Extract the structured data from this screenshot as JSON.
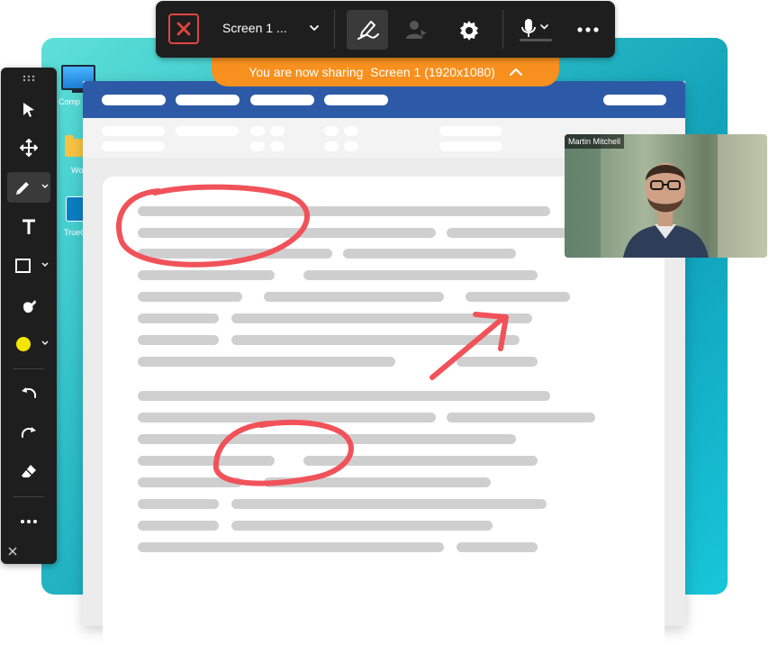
{
  "topbar": {
    "screen_select": "Screen 1 ..."
  },
  "share_banner": {
    "prefix": "You are now sharing",
    "screen": "Screen 1 (1920x1080)"
  },
  "desktop": {
    "icons": [
      {
        "label": "Comp"
      },
      {
        "label": "Wo"
      },
      {
        "label": "TrueC"
      }
    ]
  },
  "video": {
    "participant": "Martin Mitchell"
  },
  "colors": {
    "share_orange": "#f7901e",
    "annotation_red": "#f1525a",
    "highlighter_yellow": "#f2e600",
    "close_red": "#e0463d",
    "titlebar_blue": "#2d5aa6"
  },
  "toolbar": {
    "tools": [
      {
        "icon": "cursor-icon"
      },
      {
        "icon": "move-icon"
      },
      {
        "icon": "pen-icon"
      },
      {
        "icon": "text-icon"
      },
      {
        "icon": "rectangle-icon"
      },
      {
        "icon": "spotlight-icon"
      },
      {
        "icon": "color-picker-icon"
      },
      {
        "icon": "undo-icon"
      },
      {
        "icon": "redo-icon"
      },
      {
        "icon": "eraser-icon"
      },
      {
        "icon": "more-icon"
      },
      {
        "icon": "close-icon"
      }
    ]
  }
}
